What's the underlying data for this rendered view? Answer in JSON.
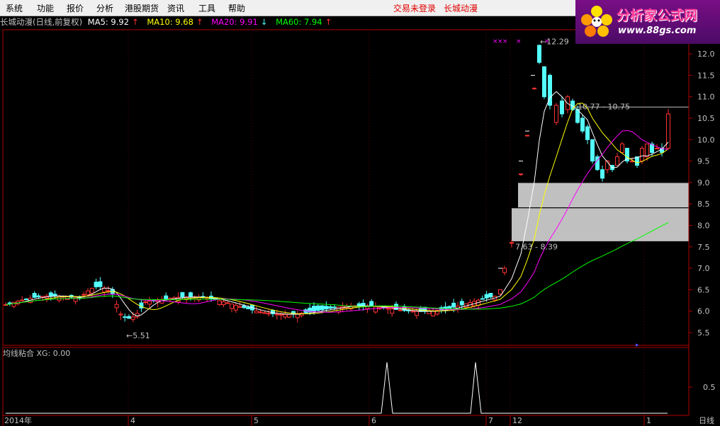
{
  "menu": {
    "items": [
      "系统",
      "功能",
      "报价",
      "分析",
      "港股期货",
      "资讯",
      "工具",
      "帮助"
    ],
    "status_text": "交易未登录",
    "stock_name": "长城动漫"
  },
  "logo": {
    "title": "分析家公式网",
    "url": "www.88gs.com"
  },
  "header": {
    "title": "长城动漫(日线,前复权)",
    "ma5_label": "MA5: 9.92",
    "ma10_label": "MA10: 9.68",
    "ma20_label": "MA20: 9.91",
    "ma60_label": "MA60: 7.94",
    "ma5_arrow": "↑",
    "ma10_arrow": "↑",
    "ma20_arrow": "↓",
    "ma60_arrow": "↑"
  },
  "colors": {
    "up": "#ff3232",
    "down": "#54ffff",
    "ma5": "#ffffff",
    "ma10": "#ffff00",
    "ma20": "#ff00ff",
    "ma60": "#00ff00",
    "axis": "#b00000",
    "zone": "#c0c0c0"
  },
  "chart_data": {
    "type": "candlestick",
    "price_axis_ticks": [
      5.5,
      6.0,
      6.5,
      7.0,
      7.5,
      8.0,
      8.5,
      9.0,
      9.5,
      10.0,
      10.5,
      11.0,
      11.5,
      12.0
    ],
    "ylim": [
      5.2,
      12.3
    ],
    "month_labels": [
      "2014年",
      "4",
      "5",
      "6",
      "7",
      "12",
      "1"
    ],
    "annotations": {
      "low_label": "←5.51",
      "high_label": "←12.29",
      "upper_range_label": "10.77 - 10.75",
      "lower_range_label": "7.63 - 8.39"
    },
    "indicator": {
      "title": "均线粘合  XG: 0.00",
      "axis_label": "0.5",
      "spikes": 2
    },
    "period_label": "日线"
  }
}
